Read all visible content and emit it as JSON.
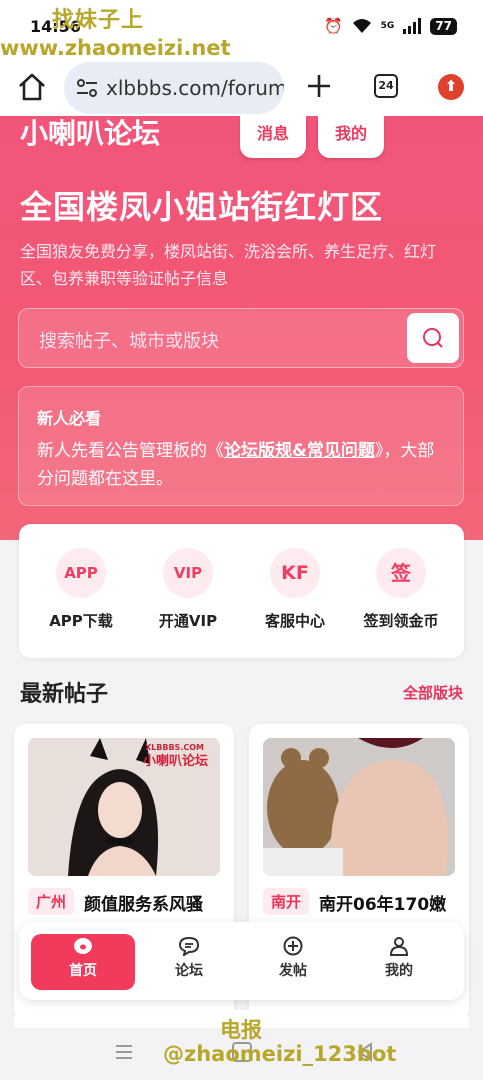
{
  "status_bar": {
    "time": "14:56",
    "signal_label": "5G",
    "battery": "77"
  },
  "watermark": {
    "top": "找妹子上",
    "url": "www.zhaomeizi.net",
    "tg_label": "电报",
    "tg_handle": "@zhaomeizi_123bot"
  },
  "browser": {
    "url": "xlbbbs.com/forum",
    "tab_count": "24"
  },
  "header": {
    "logo": "小喇叭论坛",
    "messages_label": "消息",
    "mine_label": "我的"
  },
  "hero": {
    "title": "全国楼凤小姐站街红灯区",
    "subtitle": "全国狼友免费分享，楼凤站街、洗浴会所、养生足疗、红灯区、包养兼职等验证帖子信息"
  },
  "search": {
    "placeholder": "搜索帖子、城市或版块"
  },
  "notice": {
    "title": "新人必看",
    "text_before": "新人先看公告管理板的《",
    "link": "论坛版规&常见问题",
    "text_after": "》，大部分问题都在这里。"
  },
  "quick_actions": [
    {
      "icon_text": "APP",
      "label": "APP下载"
    },
    {
      "icon_text": "VIP",
      "label": "开通VIP"
    },
    {
      "icon_text": "KF",
      "label": "客服中心"
    },
    {
      "icon_text": "签",
      "label": "签到领金币"
    }
  ],
  "latest": {
    "title": "最新帖子",
    "all_sections": "全部版块",
    "posts": [
      {
        "tag": "广州",
        "title": "颜值服务系风骚",
        "image_watermark_top": "XLBBBS.COM",
        "image_watermark_bottom": "小喇叭论坛"
      },
      {
        "tag": "南开",
        "title": "南开06年170嫩"
      }
    ]
  },
  "tabbar": [
    {
      "label": "首页",
      "icon": "home-icon",
      "active": true
    },
    {
      "label": "论坛",
      "icon": "chat-icon",
      "active": false
    },
    {
      "label": "发帖",
      "icon": "plus-circle-icon",
      "active": false
    },
    {
      "label": "我的",
      "icon": "user-icon",
      "active": false
    }
  ],
  "colors": {
    "accent": "#f23a5c",
    "hero": "#f35874",
    "watermark": "#b7a72a"
  }
}
